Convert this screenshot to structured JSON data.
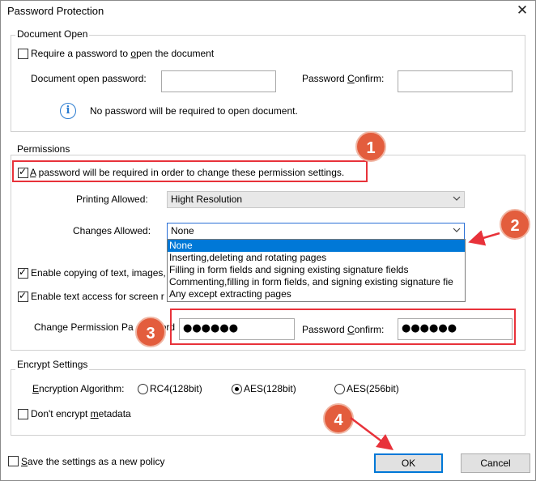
{
  "window": {
    "title": "Password Protection",
    "close_glyph": "✕"
  },
  "document_open": {
    "legend": "Document Open",
    "require_checkbox": {
      "label_pre": "Require a password to ",
      "label_u": "o",
      "label_post": "pen the document",
      "checked": false
    },
    "open_password_label": "Document open password:",
    "open_password_value": "",
    "confirm_label_pre": "Password ",
    "confirm_label_u": "C",
    "confirm_label_post": "onfirm:",
    "confirm_value": "",
    "info_icon": "info-icon",
    "info_text": "No password will be required to open document."
  },
  "permissions": {
    "legend": "Permissions",
    "require_checkbox": {
      "label_pre": "",
      "label_u": "A",
      "label_post": " password will be required in order to change these permission settings.",
      "checked": true
    },
    "printing_label": "Printing Allowed:",
    "printing_value": "Hight Resolution",
    "changes_label": "Changes Allowed:",
    "changes_value": "None",
    "changes_options": [
      "None",
      "Inserting,deleting and rotating pages",
      "Filling in form fields and signing existing signature fields",
      "Commenting,filling in form fields, and signing existing signature fie",
      "Any except extracting pages"
    ],
    "copy_checkbox": {
      "label": "Enable copying of text, images,",
      "checked": true
    },
    "screen_checkbox": {
      "label": "Enable text access for screen r",
      "checked": true
    },
    "change_pw_label_pre": "Change Permission Pa",
    "change_pw_label_post": "ord",
    "change_pw_value": "●●●●●●",
    "confirm_label_pre": "Password ",
    "confirm_label_u": "C",
    "confirm_label_post": "onfirm:",
    "confirm_value": "●●●●●●"
  },
  "encrypt": {
    "legend": "Encrypt Settings",
    "algorithm_label_u": "E",
    "algorithm_label_post": "ncryption Algorithm:",
    "options": [
      {
        "label": "RC4(128bit)",
        "checked": false
      },
      {
        "label": "AES(128bit)",
        "checked": true
      },
      {
        "label": "AES(256bit)",
        "checked": false
      }
    ],
    "metadata_checkbox": {
      "label_pre": "Don't encrypt ",
      "label_u": "m",
      "label_post": "etadata",
      "checked": false
    }
  },
  "footer": {
    "save_policy": {
      "label_pre": "",
      "label_u": "S",
      "label_post": "ave the settings as a new policy",
      "checked": false
    },
    "ok_label": "OK",
    "cancel_label": "Cancel"
  },
  "annotations": {
    "badges": [
      "1",
      "2",
      "3",
      "4"
    ],
    "accent_color": "#e35d3d",
    "highlight_color": "#e8323a"
  }
}
